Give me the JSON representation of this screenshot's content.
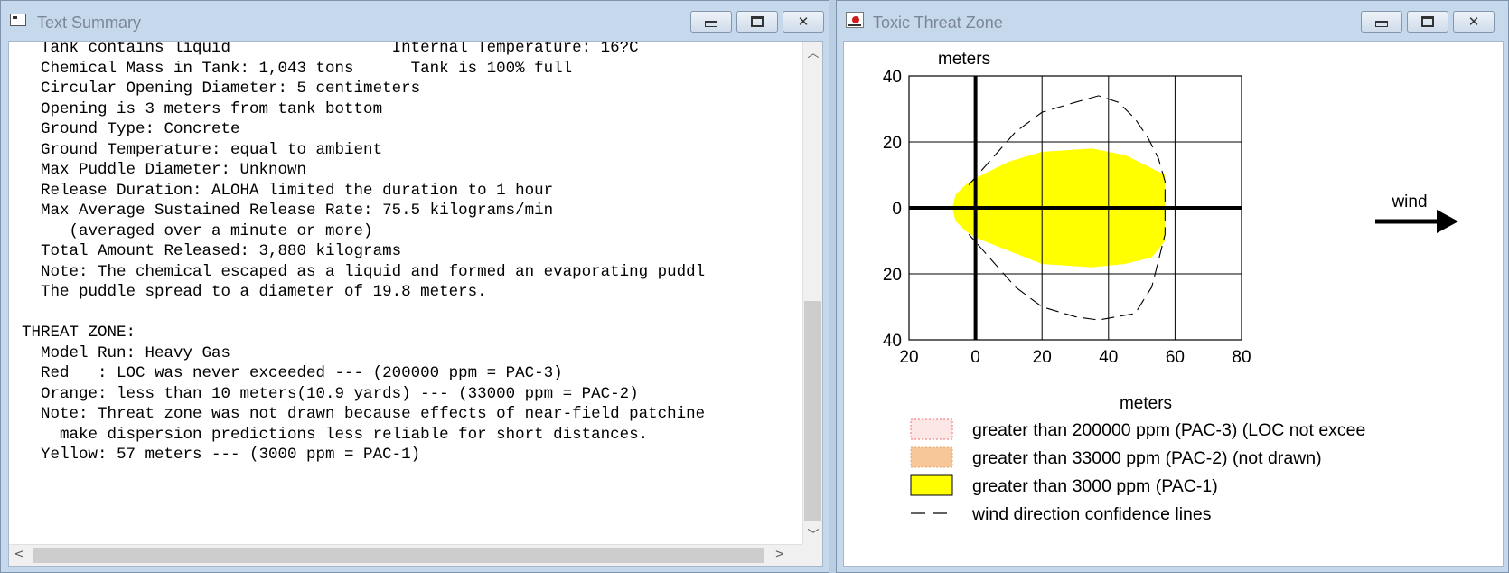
{
  "text_window": {
    "title": "Text Summary",
    "lines": [
      "  Tank contains liquid                 Internal Temperature: 16?C",
      "  Chemical Mass in Tank: 1,043 tons      Tank is 100% full",
      "  Circular Opening Diameter: 5 centimeters",
      "  Opening is 3 meters from tank bottom",
      "  Ground Type: Concrete",
      "  Ground Temperature: equal to ambient",
      "  Max Puddle Diameter: Unknown",
      "  Release Duration: ALOHA limited the duration to 1 hour",
      "  Max Average Sustained Release Rate: 75.5 kilograms/min",
      "     (averaged over a minute or more)",
      "  Total Amount Released: 3,880 kilograms",
      "  Note: The chemical escaped as a liquid and formed an evaporating puddl",
      "  The puddle spread to a diameter of 19.8 meters.",
      "",
      "THREAT ZONE:",
      "  Model Run: Heavy Gas",
      "  Red   : LOC was never exceeded --- (200000 ppm = PAC-3)",
      "  Orange: less than 10 meters(10.9 yards) --- (33000 ppm = PAC-2)",
      "  Note: Threat zone was not drawn because effects of near-field patchine",
      "    make dispersion predictions less reliable for short distances.",
      "  Yellow: 57 meters --- (3000 ppm = PAC-1)"
    ]
  },
  "plot_window": {
    "title": "Toxic Threat Zone",
    "wind_label": "wind",
    "legend": [
      {
        "label": "greater than 200000 ppm (PAC-3) (LOC not excee",
        "style": "red-dotted"
      },
      {
        "label": "greater than 33000 ppm (PAC-2) (not drawn)",
        "style": "orange-dotted"
      },
      {
        "label": "greater than 3000 ppm (PAC-1)",
        "style": "yellow-solid"
      },
      {
        "label": "wind direction confidence lines",
        "style": "dashed-line"
      }
    ]
  },
  "chart_data": {
    "type": "area",
    "xlabel": "meters",
    "ylabel": "meters",
    "xlim": [
      -20,
      80
    ],
    "ylim": [
      -40,
      40
    ],
    "x_ticks": [
      "20",
      "0",
      "20",
      "40",
      "60",
      "80"
    ],
    "y_ticks": [
      "40",
      "20",
      "0",
      "20",
      "40"
    ],
    "grid": true,
    "series": [
      {
        "name": "greater than 3000 ppm (PAC-1)",
        "color": "#ffff00",
        "polygon": [
          [
            -7,
            0
          ],
          [
            -6,
            4
          ],
          [
            -3,
            7
          ],
          [
            0,
            9
          ],
          [
            10,
            14
          ],
          [
            20,
            17
          ],
          [
            35,
            18
          ],
          [
            45,
            16
          ],
          [
            53,
            12
          ],
          [
            57,
            10
          ],
          [
            57,
            0
          ],
          [
            57,
            -10
          ],
          [
            53,
            -15
          ],
          [
            45,
            -17
          ],
          [
            35,
            -18
          ],
          [
            20,
            -17
          ],
          [
            10,
            -13
          ],
          [
            0,
            -9
          ],
          [
            -3,
            -7
          ],
          [
            -6,
            -4
          ]
        ]
      },
      {
        "name": "wind direction confidence lines",
        "color": "#000000",
        "polyline": [
          [
            -2,
            7
          ],
          [
            5,
            15
          ],
          [
            12,
            23
          ],
          [
            20,
            29
          ],
          [
            30,
            32
          ],
          [
            37,
            34
          ],
          [
            43,
            32
          ],
          [
            48,
            27
          ],
          [
            52,
            21
          ],
          [
            55,
            15
          ],
          [
            57,
            8
          ],
          [
            57,
            0
          ],
          [
            57,
            -8
          ],
          [
            55,
            -16
          ],
          [
            53,
            -24
          ],
          [
            48,
            -32
          ],
          [
            37,
            -34
          ],
          [
            30,
            -33
          ],
          [
            20,
            -30
          ],
          [
            12,
            -24
          ],
          [
            5,
            -16
          ],
          [
            -2,
            -8
          ]
        ]
      }
    ],
    "colors": {
      "pac1": "#ffff00",
      "pac2": "#f7c79a",
      "pac3": "#f26d6d",
      "axis": "#000000"
    }
  }
}
